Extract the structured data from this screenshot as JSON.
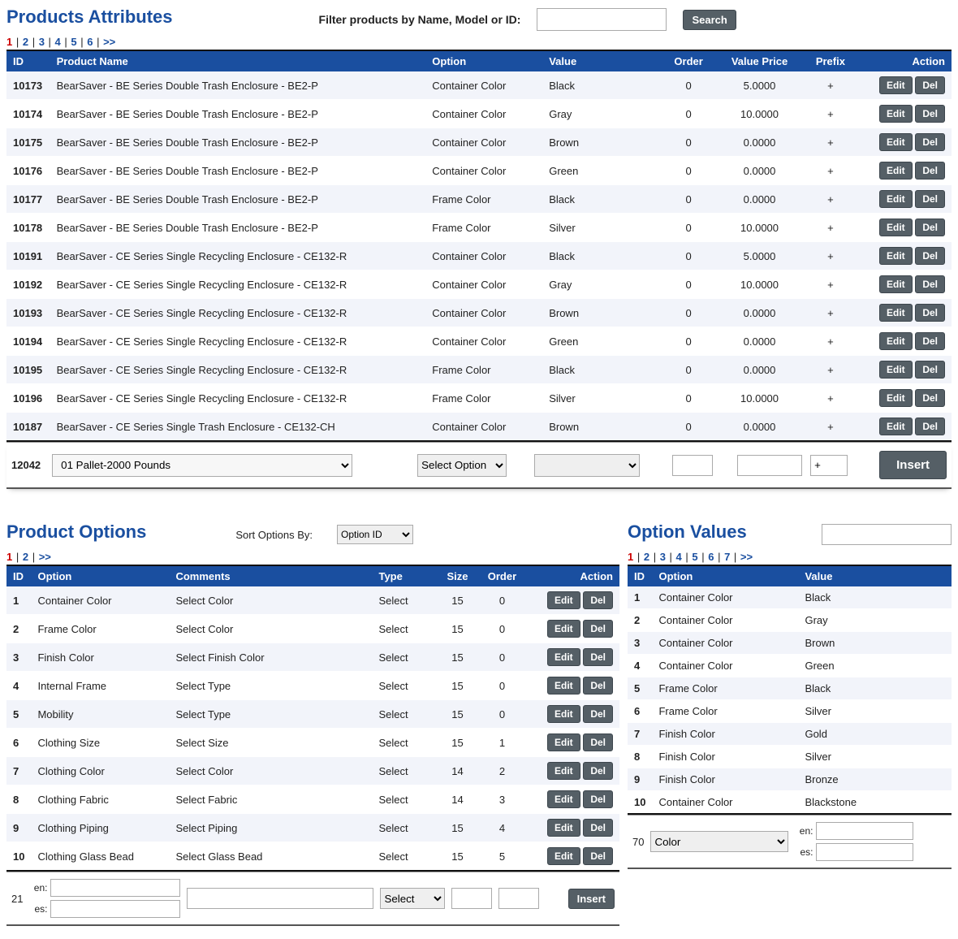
{
  "attributes": {
    "title": "Products Attributes",
    "filterLabel": "Filter products by Name, Model or ID:",
    "searchBtn": "Search",
    "pager": {
      "pages": [
        "1",
        "2",
        "3",
        "4",
        "5",
        "6"
      ],
      "active": 0,
      "next": ">>"
    },
    "columns": {
      "id": "ID",
      "name": "Product Name",
      "option": "Option",
      "value": "Value",
      "order": "Order",
      "price": "Value Price",
      "prefix": "Prefix",
      "action": "Action"
    },
    "editBtn": "Edit",
    "delBtn": "Del",
    "rows": [
      {
        "id": "10173",
        "name": "BearSaver - BE Series Double Trash Enclosure - BE2-P",
        "option": "Container Color",
        "value": "Black",
        "order": "0",
        "price": "5.0000",
        "prefix": "+"
      },
      {
        "id": "10174",
        "name": "BearSaver - BE Series Double Trash Enclosure - BE2-P",
        "option": "Container Color",
        "value": "Gray",
        "order": "0",
        "price": "10.0000",
        "prefix": "+"
      },
      {
        "id": "10175",
        "name": "BearSaver - BE Series Double Trash Enclosure - BE2-P",
        "option": "Container Color",
        "value": "Brown",
        "order": "0",
        "price": "0.0000",
        "prefix": "+"
      },
      {
        "id": "10176",
        "name": "BearSaver - BE Series Double Trash Enclosure - BE2-P",
        "option": "Container Color",
        "value": "Green",
        "order": "0",
        "price": "0.0000",
        "prefix": "+"
      },
      {
        "id": "10177",
        "name": "BearSaver - BE Series Double Trash Enclosure - BE2-P",
        "option": "Frame Color",
        "value": "Black",
        "order": "0",
        "price": "0.0000",
        "prefix": "+"
      },
      {
        "id": "10178",
        "name": "BearSaver - BE Series Double Trash Enclosure - BE2-P",
        "option": "Frame Color",
        "value": "Silver",
        "order": "0",
        "price": "10.0000",
        "prefix": "+"
      },
      {
        "id": "10191",
        "name": "BearSaver - CE Series Single Recycling Enclosure - CE132-R",
        "option": "Container Color",
        "value": "Black",
        "order": "0",
        "price": "5.0000",
        "prefix": "+"
      },
      {
        "id": "10192",
        "name": "BearSaver - CE Series Single Recycling Enclosure - CE132-R",
        "option": "Container Color",
        "value": "Gray",
        "order": "0",
        "price": "10.0000",
        "prefix": "+"
      },
      {
        "id": "10193",
        "name": "BearSaver - CE Series Single Recycling Enclosure - CE132-R",
        "option": "Container Color",
        "value": "Brown",
        "order": "0",
        "price": "0.0000",
        "prefix": "+"
      },
      {
        "id": "10194",
        "name": "BearSaver - CE Series Single Recycling Enclosure - CE132-R",
        "option": "Container Color",
        "value": "Green",
        "order": "0",
        "price": "0.0000",
        "prefix": "+"
      },
      {
        "id": "10195",
        "name": "BearSaver - CE Series Single Recycling Enclosure - CE132-R",
        "option": "Frame Color",
        "value": "Black",
        "order": "0",
        "price": "0.0000",
        "prefix": "+"
      },
      {
        "id": "10196",
        "name": "BearSaver - CE Series Single Recycling Enclosure - CE132-R",
        "option": "Frame Color",
        "value": "Silver",
        "order": "0",
        "price": "10.0000",
        "prefix": "+"
      },
      {
        "id": "10187",
        "name": "BearSaver - CE Series Single Trash Enclosure - CE132-CH",
        "option": "Container Color",
        "value": "Brown",
        "order": "0",
        "price": "0.0000",
        "prefix": "+"
      }
    ],
    "insert": {
      "id": "12042",
      "product": "01 Pallet-2000 Pounds",
      "optionPlaceholder": "Select Option",
      "prefixVal": "+",
      "btn": "Insert"
    }
  },
  "options": {
    "title": "Product Options",
    "sortLabel": "Sort Options By:",
    "sortValue": "Option ID",
    "pager": {
      "pages": [
        "1",
        "2"
      ],
      "active": 0,
      "next": ">>"
    },
    "columns": {
      "id": "ID",
      "option": "Option",
      "comments": "Comments",
      "type": "Type",
      "size": "Size",
      "order": "Order",
      "action": "Action"
    },
    "editBtn": "Edit",
    "delBtn": "Del",
    "rows": [
      {
        "id": "1",
        "option": "Container Color",
        "comments": "Select Color",
        "type": "Select",
        "size": "15",
        "order": "0"
      },
      {
        "id": "2",
        "option": "Frame Color",
        "comments": "Select Color",
        "type": "Select",
        "size": "15",
        "order": "0"
      },
      {
        "id": "3",
        "option": "Finish Color",
        "comments": "Select Finish Color",
        "type": "Select",
        "size": "15",
        "order": "0"
      },
      {
        "id": "4",
        "option": "Internal Frame",
        "comments": "Select Type",
        "type": "Select",
        "size": "15",
        "order": "0"
      },
      {
        "id": "5",
        "option": "Mobility",
        "comments": "Select Type",
        "type": "Select",
        "size": "15",
        "order": "0"
      },
      {
        "id": "6",
        "option": "Clothing Size",
        "comments": "Select Size",
        "type": "Select",
        "size": "15",
        "order": "1"
      },
      {
        "id": "7",
        "option": "Clothing Color",
        "comments": "Select Color",
        "type": "Select",
        "size": "14",
        "order": "2"
      },
      {
        "id": "8",
        "option": "Clothing Fabric",
        "comments": "Select Fabric",
        "type": "Select",
        "size": "14",
        "order": "3"
      },
      {
        "id": "9",
        "option": "Clothing Piping",
        "comments": "Select Piping",
        "type": "Select",
        "size": "15",
        "order": "4"
      },
      {
        "id": "10",
        "option": "Clothing Glass Bead",
        "comments": "Select Glass Bead",
        "type": "Select",
        "size": "15",
        "order": "5"
      }
    ],
    "insert": {
      "id": "21",
      "en": "en:",
      "es": "es:",
      "typeVal": "Select",
      "btn": "Insert"
    }
  },
  "values": {
    "title": "Option Values",
    "pager": {
      "pages": [
        "1",
        "2",
        "3",
        "4",
        "5",
        "6",
        "7"
      ],
      "active": 0,
      "next": ">>"
    },
    "columns": {
      "id": "ID",
      "option": "Option",
      "value": "Value"
    },
    "rows": [
      {
        "id": "1",
        "option": "Container Color",
        "value": "Black"
      },
      {
        "id": "2",
        "option": "Container Color",
        "value": "Gray"
      },
      {
        "id": "3",
        "option": "Container Color",
        "value": "Brown"
      },
      {
        "id": "4",
        "option": "Container Color",
        "value": "Green"
      },
      {
        "id": "5",
        "option": "Frame Color",
        "value": "Black"
      },
      {
        "id": "6",
        "option": "Frame Color",
        "value": "Silver"
      },
      {
        "id": "7",
        "option": "Finish Color",
        "value": "Gold"
      },
      {
        "id": "8",
        "option": "Finish Color",
        "value": "Silver"
      },
      {
        "id": "9",
        "option": "Finish Color",
        "value": "Bronze"
      },
      {
        "id": "10",
        "option": "Container Color",
        "value": "Blackstone"
      }
    ],
    "insert": {
      "id": "70",
      "optVal": "Color",
      "en": "en:",
      "es": "es:"
    }
  }
}
